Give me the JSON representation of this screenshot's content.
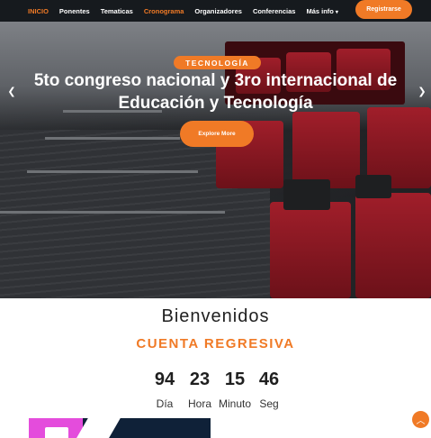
{
  "nav": {
    "items": [
      "INICIO",
      "Ponentes",
      "Tematicas",
      "Cronograma",
      "Organizadores",
      "Conferencias",
      "Más info"
    ],
    "active_index": 0,
    "highlight_index": 3,
    "cta": "Registrarse"
  },
  "hero": {
    "badge": "TECNOLOGÍA",
    "title": "5to congreso nacional y 3ro internacional de Educación y Tecnología",
    "button": "Explore More"
  },
  "welcome": {
    "heading": "Bienvenidos",
    "countdown_title": "CUENTA REGRESIVA",
    "values": {
      "days": "94",
      "hours": "23",
      "minutes": "15",
      "seconds": "46"
    },
    "labels": {
      "days": "Día",
      "hours": "Hora",
      "minutes": "Minuto",
      "seconds": "Seg"
    }
  },
  "colors": {
    "accent": "#f07a26",
    "nav_bg": "#161a1e"
  },
  "icons": {
    "prev": "chevron-left-icon",
    "next": "chevron-right-icon",
    "dropdown": "caret-down-icon",
    "back_to_top": "chevron-up-icon"
  }
}
